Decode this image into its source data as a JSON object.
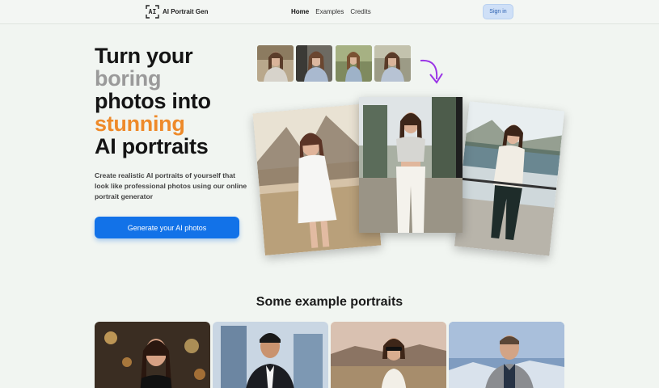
{
  "header": {
    "logo_icon_text": "AI",
    "brand": "AI Portrait Gen",
    "nav": [
      {
        "label": "Home",
        "active": true
      },
      {
        "label": "Examples",
        "active": false
      },
      {
        "label": "Credits",
        "active": false
      }
    ],
    "signin_label": "Sign in"
  },
  "hero": {
    "headline_lines": [
      "Turn your",
      "boring",
      "photos into",
      "stunning",
      "AI portraits"
    ],
    "subtitle": "Create realistic AI portraits of yourself that look like professional photos using our online portrait generator",
    "cta_label": "Generate your AI photos",
    "accent_color": "#ee8a2a",
    "muted_color": "#9a9a9a",
    "button_color": "#1272e8"
  },
  "examples": {
    "title": "Some example portraits"
  }
}
